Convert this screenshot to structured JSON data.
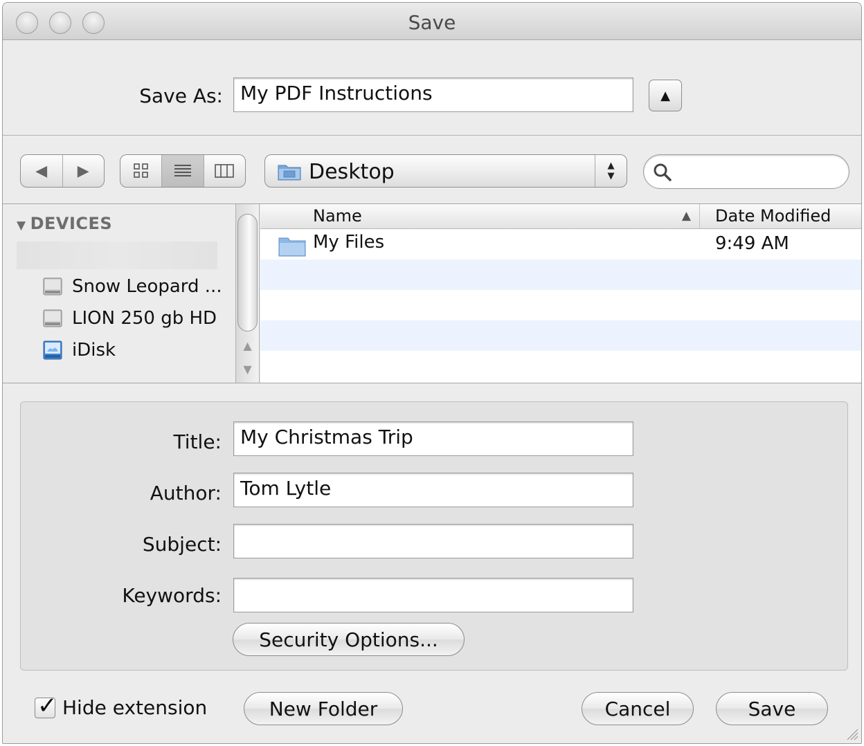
{
  "window": {
    "title": "Save"
  },
  "save_as": {
    "label": "Save As:",
    "value": "My PDF Instructions",
    "disclosure_icon": "triangle-up-icon"
  },
  "toolbar": {
    "back_icon": "◀",
    "forward_icon": "▶",
    "view_icons": [
      "icon-view-icon",
      "list-view-icon",
      "column-view-icon"
    ],
    "location": "Desktop",
    "search_placeholder": ""
  },
  "sidebar": {
    "header": "DEVICES",
    "items": [
      {
        "label": "Snow Leopard  ...",
        "icon": "hard-drive-icon"
      },
      {
        "label": "LION 250 gb HD",
        "icon": "hard-drive-icon"
      },
      {
        "label": "iDisk",
        "icon": "idisk-icon"
      }
    ]
  },
  "file_list": {
    "columns": {
      "name": "Name",
      "date": "Date Modified"
    },
    "sort_indicator": "▲",
    "rows": [
      {
        "name": "My Files",
        "date": "9:49 AM",
        "icon": "folder-icon"
      }
    ]
  },
  "pdf_options": {
    "title_label": "Title:",
    "title_value": "My Christmas Trip",
    "author_label": "Author:",
    "author_value": "Tom Lytle",
    "subject_label": "Subject:",
    "subject_value": "",
    "keywords_label": "Keywords:",
    "keywords_value": "",
    "security_button": "Security Options..."
  },
  "bottom": {
    "hide_extension_label": "Hide extension",
    "hide_extension_checked": true,
    "new_folder": "New Folder",
    "cancel": "Cancel",
    "save": "Save"
  }
}
